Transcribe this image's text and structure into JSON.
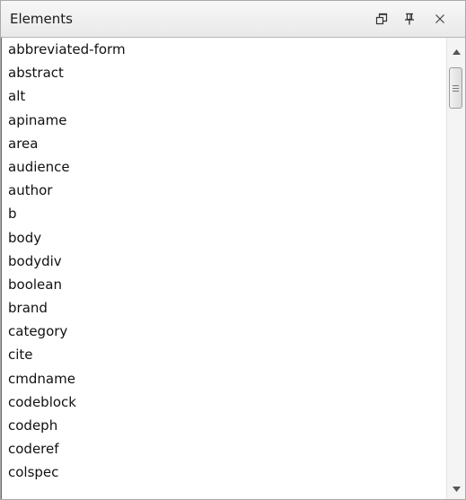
{
  "panel": {
    "title": "Elements",
    "buttons": {
      "restore_icon": "restore-window-icon",
      "pin_icon": "pin-icon",
      "close_icon": "close-icon"
    }
  },
  "elements": [
    "abbreviated-form",
    "abstract",
    "alt",
    "apiname",
    "area",
    "audience",
    "author",
    "b",
    "body",
    "bodydiv",
    "boolean",
    "brand",
    "category",
    "cite",
    "cmdname",
    "codeblock",
    "codeph",
    "coderef",
    "colspec"
  ],
  "scrollbar": {
    "up_icon": "scroll-up-arrow-icon",
    "down_icon": "scroll-down-arrow-icon",
    "thumb_grip_icon": "grip-icon"
  },
  "colors": {
    "titlebar_bg": "#eeeeee",
    "border": "#a9a9a9",
    "text": "#111111"
  }
}
